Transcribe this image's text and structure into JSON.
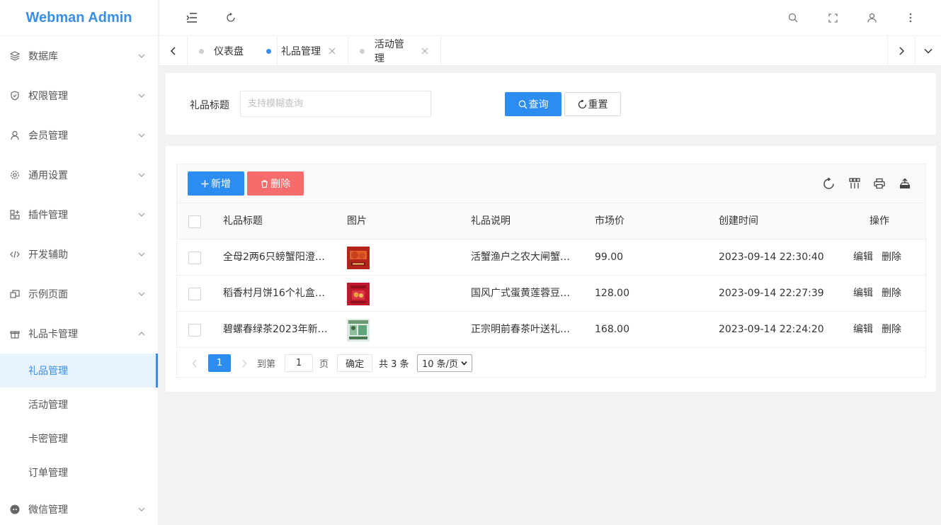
{
  "app": {
    "title": "Webman Admin",
    "accent": "#3a8ee6",
    "primary": "#2d8cf0",
    "danger": "#f56c6c"
  },
  "sidebar": {
    "items": [
      {
        "label": "数据库",
        "icon": "layers-icon"
      },
      {
        "label": "权限管理",
        "icon": "shield-icon"
      },
      {
        "label": "会员管理",
        "icon": "user-icon"
      },
      {
        "label": "通用设置",
        "icon": "gear-icon"
      },
      {
        "label": "插件管理",
        "icon": "plugin-icon"
      },
      {
        "label": "开发辅助",
        "icon": "code-icon"
      },
      {
        "label": "示例页面",
        "icon": "pages-icon"
      },
      {
        "label": "礼品卡管理",
        "icon": "gift-icon"
      },
      {
        "label": "微信管理",
        "icon": "wechat-icon"
      }
    ],
    "subitems": [
      {
        "label": "礼品管理",
        "active": true
      },
      {
        "label": "活动管理"
      },
      {
        "label": "卡密管理"
      },
      {
        "label": "订单管理"
      }
    ]
  },
  "tabs": [
    {
      "label": "仪表盘",
      "active": false,
      "closable": false
    },
    {
      "label": "礼品管理",
      "active": true,
      "closable": true
    },
    {
      "label": "活动管理",
      "active": false,
      "closable": true
    }
  ],
  "search": {
    "label": "礼品标题",
    "placeholder": "支持模糊查询",
    "query_label": "查询",
    "reset_label": "重置"
  },
  "toolbar": {
    "add_label": "新增",
    "delete_label": "删除"
  },
  "table": {
    "headers": [
      "礼品标题",
      "图片",
      "礼品说明",
      "市场价",
      "创建时间",
      "操作"
    ],
    "rows": [
      {
        "title": "全母2两6只螃蟹阳澄…",
        "desc": "活蟹渔户之农大闸蟹…",
        "price": "99.00",
        "created": "2023-09-14 22:30:40",
        "edit": "编辑",
        "delete": "删除"
      },
      {
        "title": "稻香村月饼16个礼盒…",
        "desc": "国风广式蛋黄莲蓉豆…",
        "price": "128.00",
        "created": "2023-09-14 22:27:39",
        "edit": "编辑",
        "delete": "删除"
      },
      {
        "title": "碧螺春绿茶2023年新…",
        "desc": "正宗明前春茶叶送礼…",
        "price": "168.00",
        "created": "2023-09-14 22:24:20",
        "edit": "编辑",
        "delete": "删除"
      }
    ]
  },
  "pagination": {
    "current": "1",
    "goto_prefix": "到第",
    "goto_value": "1",
    "goto_suffix": "页",
    "confirm": "确定",
    "total": "共 3 条",
    "page_size": "10 条/页"
  }
}
